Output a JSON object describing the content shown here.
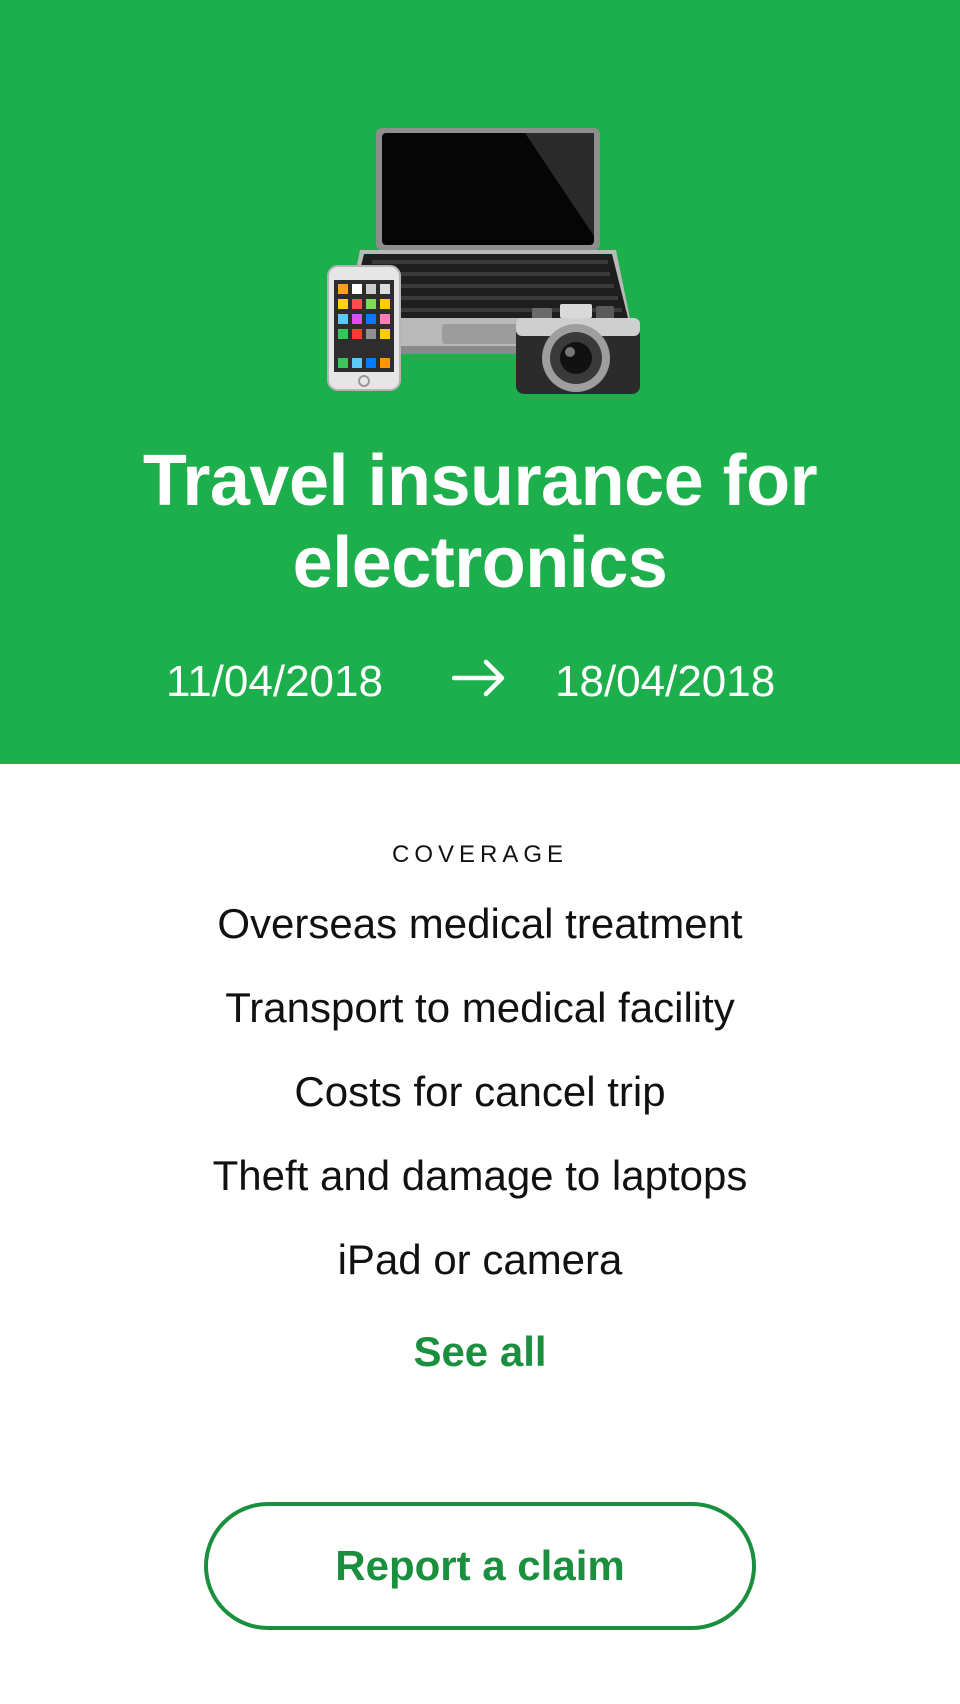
{
  "colors": {
    "hero_background": "#1caf4c",
    "accent": "#1a8f3e",
    "text": "#111111",
    "background": "#ffffff"
  },
  "header": {
    "illustration": [
      "laptop-icon",
      "smartphone-icon",
      "camera-icon"
    ],
    "title": "Travel insurance for electronics",
    "start_date": "11/04/2018",
    "end_date": "18/04/2018",
    "arrow_icon": "arrow-right-icon"
  },
  "coverage": {
    "heading": "COVERAGE",
    "items": [
      "Overseas medical treatment",
      "Transport to medical facility",
      "Costs for cancel trip",
      "Theft and damage to laptops",
      "iPad or camera"
    ],
    "see_all_label": "See all"
  },
  "actions": {
    "report_claim_label": "Report a claim"
  }
}
